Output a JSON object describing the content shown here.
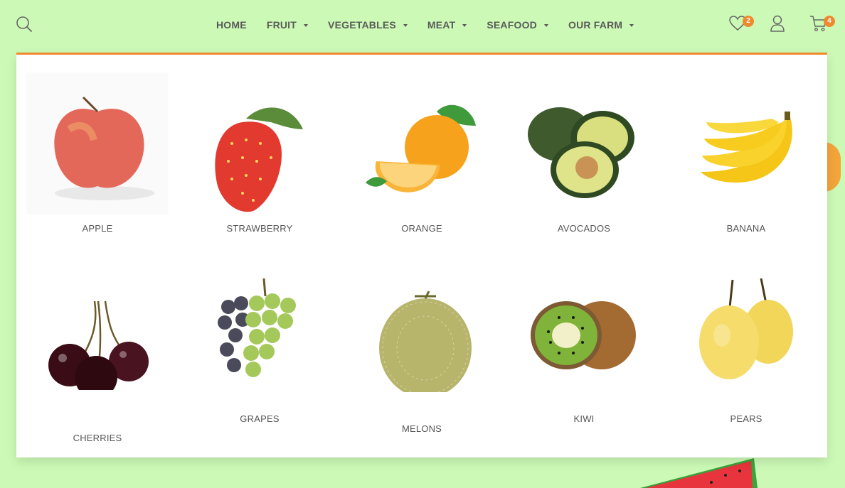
{
  "nav": {
    "items": [
      {
        "label": "HOME",
        "has_dropdown": false
      },
      {
        "label": "FRUIT",
        "has_dropdown": true
      },
      {
        "label": "VEGETABLES",
        "has_dropdown": true
      },
      {
        "label": "MEAT",
        "has_dropdown": true
      },
      {
        "label": "SEAFOOD",
        "has_dropdown": true
      },
      {
        "label": "OUR FARM",
        "has_dropdown": true
      }
    ]
  },
  "header": {
    "wishlist_count": "2",
    "cart_count": "4",
    "icons": [
      "search-icon",
      "heart-icon",
      "user-icon",
      "cart-icon"
    ]
  },
  "mega_menu": {
    "items": [
      {
        "label": "APPLE",
        "icon": "apple-image"
      },
      {
        "label": "STRAWBERRY",
        "icon": "strawberry-image"
      },
      {
        "label": "ORANGE",
        "icon": "orange-image"
      },
      {
        "label": "AVOCADOS",
        "icon": "avocado-image"
      },
      {
        "label": "BANANA",
        "icon": "banana-image"
      },
      {
        "label": "CHERRIES",
        "icon": "cherries-image"
      },
      {
        "label": "GRAPES",
        "icon": "grapes-image"
      },
      {
        "label": "MELONS",
        "icon": "melon-image"
      },
      {
        "label": "KIWI",
        "icon": "kiwi-image"
      },
      {
        "label": "PEARS",
        "icon": "pears-image"
      }
    ]
  },
  "colors": {
    "background": "#ccfab6",
    "accent": "#f0892d",
    "nav_text": "#5a5a5a"
  }
}
